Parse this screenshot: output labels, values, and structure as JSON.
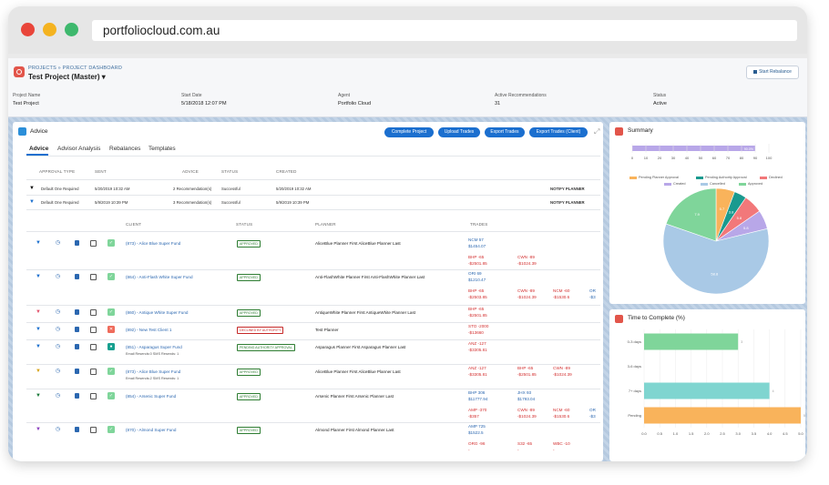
{
  "browser": {
    "url": "portfoliocloud.com.au"
  },
  "header": {
    "breadcrumb": "PROJECTS » PROJECT DASHBOARD",
    "title": "Test Project (Master)",
    "rebalance_label": "Start Rebalance",
    "meta": [
      {
        "label": "Project Name",
        "value": "Test Project"
      },
      {
        "label": "Start Date",
        "value": "5/18/2018 12:07 PM"
      },
      {
        "label": "Agent",
        "value": "Portfolio Cloud"
      },
      {
        "label": "Active Recommendations",
        "value": "31"
      },
      {
        "label": "Status",
        "value": "Active"
      }
    ]
  },
  "advice": {
    "title": "Advice",
    "buttons": [
      "Complete Project",
      "Upload Trades",
      "Export Trades",
      "Export Trades (Client)"
    ],
    "tabs": [
      "Advice",
      "Advisor Analysis",
      "Rebalances",
      "Templates"
    ],
    "top_headers": [
      "APPROVAL TYPE",
      "SENT",
      "ADVICE",
      "STATUS",
      "CREATED"
    ],
    "top_rows": [
      {
        "type": "Default One Required",
        "sent": "5/20/2019 10:32 AM",
        "advice": "2 Recommendation(s)",
        "status": "Successful",
        "created": "5/20/2019 10:32 AM",
        "action": "NOTIFY PLANNER"
      },
      {
        "type": "Default One Required",
        "sent": "5/9/2019 10:39 PM",
        "advice": "3 Recommendation(s)",
        "status": "Successful",
        "created": "5/9/2019 10:39 PM",
        "action": "NOTIFY PLANNER"
      }
    ],
    "headers": [
      "CLIENT",
      "STATUS",
      "PLANNER",
      "TRADES"
    ],
    "rows": [
      {
        "client": "(873) - Alice Blue Super Fund",
        "sub": "",
        "status": "APPROVED",
        "planner": "AliceBlue Planner First AliceBlue Planner Last",
        "trades": [
          [
            "NCM 57",
            "$1454.07"
          ],
          [
            "BHP -65",
            "-$2501.85",
            "CWN -89",
            "-$1024.39"
          ]
        ]
      },
      {
        "client": "(864) - Anti-Flash White Super Fund",
        "sub": "",
        "status": "APPROVED",
        "planner": "Anti-FlashWhite Planner First Anti-FlashWhite Planner Last",
        "trades": [
          [
            "ORI 69",
            "$1210.47"
          ],
          [
            "BHP -65",
            "-$2503.85",
            "CWN -89",
            "-$1024.39",
            "NCM -60",
            "-$1530.6",
            "OR",
            "-$3"
          ]
        ]
      },
      {
        "client": "(860) - Antique White Super Fund",
        "sub": "",
        "status": "APPROVED",
        "planner": "AntiqueWhite Planner First AntiqueWhite Planner Last",
        "trades": [
          [
            "BHP -65",
            "-$2501.85"
          ]
        ]
      },
      {
        "client": "(892) - New Test Client 1",
        "sub": "",
        "status": "DECLINED BY AUTHORITY",
        "planner": "Test Planner",
        "trades": [
          [
            "STO -2000",
            "-$13660"
          ]
        ]
      },
      {
        "client": "(851) - Asparagus Super Fund",
        "sub": "Email Resends:0 SMS Resends: 1",
        "status": "PENDING AUTHORITY APPROVAL",
        "planner": "Asparagus Planner First Asparagus Planner Last",
        "trades": [
          [
            "ANZ -127",
            "-$3305.81"
          ]
        ]
      },
      {
        "client": "(873) - Alice Blue Super Fund",
        "sub": "Email Resends:2 SMS Resends: 1",
        "status": "APPROVED",
        "planner": "AliceBlue Planner First AliceBlue Planner Last",
        "trades": [
          [
            "ANZ -127",
            "-$3305.81",
            "BHP -65",
            "-$2501.85",
            "CWN -89",
            "-$1024.39"
          ]
        ]
      },
      {
        "client": "(854) - Arsenic Super Fund",
        "sub": "",
        "status": "APPROVED",
        "planner": "Arsenic Planner First Arsenic Planner Last",
        "trades": [
          [
            "BHP 306",
            "$11777.94",
            "JHX 93",
            "$1793.04"
          ],
          [
            "AMP -370",
            "-$357",
            "CWN -89",
            "-$1024.39",
            "NCM -60",
            "-$1530.6",
            "OR",
            "-$3"
          ]
        ]
      },
      {
        "client": "(870) - Almond Super Fund",
        "sub": "",
        "status": "APPROVED",
        "planner": "Almond Planner First Almond Planner Last",
        "trades": [
          [
            "AMP 725",
            "$1522.5"
          ],
          [
            "ORG -96",
            "-",
            "S32 -65",
            "-",
            "WBC -10",
            "-"
          ]
        ]
      }
    ]
  },
  "summary": {
    "title": "Summary",
    "bar_label": "90.0%",
    "axis_ticks": [
      "0",
      "10",
      "20",
      "30",
      "40",
      "50",
      "60",
      "70",
      "80",
      "90",
      "100"
    ],
    "legend": [
      {
        "label": "Pending Planner Approval",
        "color": "#f9b35b"
      },
      {
        "label": "Pending Authority Approval",
        "color": "#1a9a8f"
      },
      {
        "label": "Declined",
        "color": "#f2787a"
      },
      {
        "label": "Created",
        "color": "#b8a7e8"
      },
      {
        "label": "Cancelled",
        "color": "#a9c9e6"
      },
      {
        "label": "Approved",
        "color": "#7fd59a"
      }
    ]
  },
  "chart_data": {
    "type": "pie",
    "categories": [
      "Pending Planner Approval",
      "Pending Authority Approval",
      "Declined",
      "Created",
      "Cancelled",
      "Approved"
    ],
    "values": [
      5.7,
      3.8,
      5.8,
      5.8,
      58.8,
      19.6
    ],
    "data_labels": [
      "5.7",
      "3.8",
      "5.8",
      "5.8",
      "58.8",
      "7.9"
    ]
  },
  "time_chart": {
    "title": "Time to Complete (%)",
    "categories": [
      "0-3 days",
      "3-6 days",
      "7+ days",
      "Pending"
    ],
    "values": [
      3.0,
      0,
      4.0,
      5.0
    ],
    "colors": [
      "#7fd59a",
      "#a9c9e6",
      "#7fd5d0",
      "#f9b35b"
    ],
    "ticks": [
      "0.0",
      "0.5",
      "1.0",
      "1.5",
      "2.0",
      "2.5",
      "3.0",
      "3.5",
      "4.0",
      "4.5",
      "5.0"
    ],
    "xmax": 5.0
  }
}
